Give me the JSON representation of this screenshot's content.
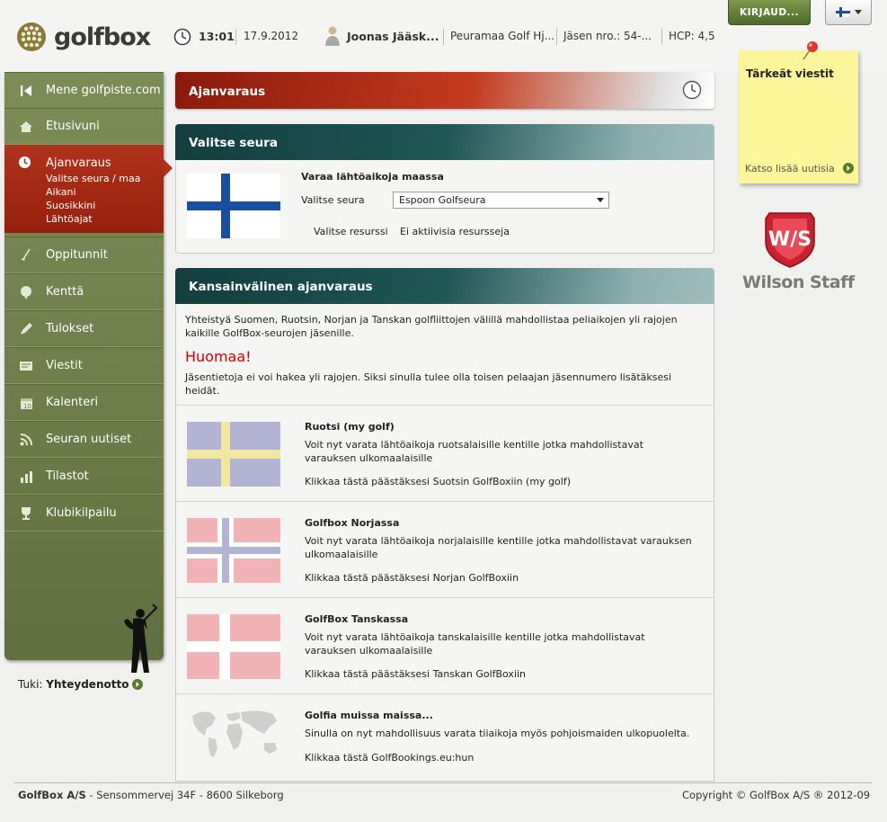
{
  "header": {
    "logo_text": "golfbox",
    "time": "13:01",
    "date": "17.9.2012",
    "user_name": "Joonas Jääsk...",
    "club": "Peuramaa Golf Hj...",
    "member_no": "Jäsen nro.: 54-...",
    "hcp": "HCP: 4,5",
    "login_label": "KIRJAUD...",
    "lang_flag_icon": "finland-flag-icon"
  },
  "sidebar": {
    "back_label": "Mene golfpiste.com",
    "items": [
      {
        "label": "Etusivuni",
        "icon": "home-icon"
      },
      {
        "label": "Ajanvaraus",
        "icon": "clock-icon"
      },
      {
        "label": "Oppitunnit",
        "icon": "club-icon"
      },
      {
        "label": "Kenttä",
        "icon": "ball-icon"
      },
      {
        "label": "Tulokset",
        "icon": "pencil-icon"
      },
      {
        "label": "Viestit",
        "icon": "message-icon"
      },
      {
        "label": "Kalenteri",
        "icon": "calendar-icon"
      },
      {
        "label": "Seuran uutiset",
        "icon": "rss-icon"
      },
      {
        "label": "Tilastot",
        "icon": "bar-chart-icon"
      },
      {
        "label": "Klubikilpailu",
        "icon": "trophy-icon"
      }
    ],
    "sub_items": [
      "Valitse seura / maa",
      "Aikani",
      "Suosikkini",
      "Lähtöajat"
    ],
    "support_prefix": "Tuki:",
    "support_link": "Yhteydenotto"
  },
  "main": {
    "title": "Ajanvaraus",
    "select_club": {
      "title": "Valitse seura",
      "heading": "Varaa lähtöaikoja maassa",
      "club_label": "Valitse seura",
      "club_value": "Espoon Golfseura",
      "resource_label": "Valitse resurssi",
      "resource_value": "Ei aktiivisia resursseja"
    },
    "international": {
      "title": "Kansainvälinen ajanvaraus",
      "intro": "Yhteistyä Suomen, Ruotsin, Norjan ja Tanskan golfliittojen välillä mahdollistaa peliaikojen yli rajojen kaikille GolfBox-seurojen jäsenille.",
      "notice_title": "Huomaa!",
      "notice_text": "Jäsentietoja ei voi hakea yli rajojen. Siksi sinulla tulee olla toisen pelaajan jäsennumero lisätäksesi heidät.",
      "countries": [
        {
          "title": "Ruotsi (my golf)",
          "text": "Voit nyt varata lähtöaikoja ruotsalaisille kentille jotka mahdollistavat varauksen ulkomaalaisille",
          "link": "Klikkaa tästä päästäksesi Suotsin GolfBoxiin (my golf)"
        },
        {
          "title": "Golfbox Norjassa",
          "text": "Voit nyt varata lähtöaikoja norjalaisille kentille jotka mahdollistavat varauksen ulkomaalaisille",
          "link": "Klikkaa tästä päästäksesi Norjan GolfBoxiin"
        },
        {
          "title": "GolfBox Tanskassa",
          "text": "Voit nyt varata lähtöaikoja tanskalaisille kentille jotka mahdollistavat varauksen ulkomaalaisille",
          "link": "Klikkaa tästä päästäksesi Tanskan GolfBoxiin"
        },
        {
          "title": "Golfia muissa maissa...",
          "text": "Sinulla on nyt mahdollisuus varata tiiaikoja myös pohjoismaiden ulkopuolelta.",
          "link": "Klikkaa tästä GolfBookings.eu:hun"
        }
      ]
    }
  },
  "right": {
    "note_title": "Tärkeät viestit",
    "note_link": "Katso lisää uutisia",
    "wilson_text": "Wilson Staff"
  },
  "footer": {
    "company": "GolfBox A/S",
    "address": " - Sensommervej 34F - 8600 Silkeborg",
    "copyright": "Copyright © GolfBox A/S ® 2012-09"
  },
  "colors": {
    "accent_green": "#6e7d4a",
    "accent_red": "#a8291a",
    "notice_red": "#d40000",
    "teal": "#1f5656"
  }
}
